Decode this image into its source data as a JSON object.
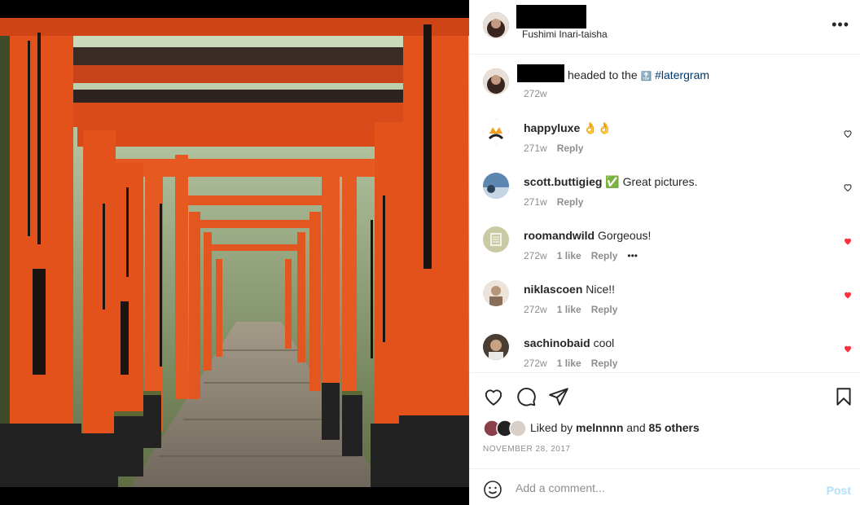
{
  "post": {
    "location": "Fushimi Inari-taisha",
    "more_icon": "more-horizontal-icon",
    "caption_before": "headed to the",
    "caption_emoji": "🔝",
    "caption_hashtag": "#latergram",
    "caption_time": "272w"
  },
  "comments": [
    {
      "user": "happyluxe",
      "text": "👌👌",
      "time": "271w",
      "likes": "",
      "reply": "Reply",
      "liked": false,
      "avatar_color": "#ffffff"
    },
    {
      "user": "scott.buttigieg",
      "text": "✅ Great pictures.",
      "time": "271w",
      "likes": "",
      "reply": "Reply",
      "liked": false,
      "avatar_color": "#4a7aa8"
    },
    {
      "user": "roomandwild",
      "text": "Gorgeous!",
      "time": "272w",
      "likes": "1 like",
      "reply": "Reply",
      "liked": true,
      "avatar_color": "#c9c9a3"
    },
    {
      "user": "niklascoen",
      "text": "Nice!!",
      "time": "272w",
      "likes": "1 like",
      "reply": "Reply",
      "liked": true,
      "avatar_color": "#d9c8b8"
    },
    {
      "user": "sachinobaid",
      "text": "cool",
      "time": "272w",
      "likes": "1 like",
      "reply": "Reply",
      "liked": true,
      "avatar_color": "#6b5a4a"
    }
  ],
  "comment_more": "•••",
  "actions": {
    "likes_prefix": "Liked by",
    "likes_user": "melnnnn",
    "likes_and": "and",
    "likes_others": "85 others",
    "date": "NOVEMBER 28, 2017"
  },
  "add_comment": {
    "placeholder": "Add a comment...",
    "post_label": "Post"
  },
  "colors": {
    "heart_red": "#ff3040",
    "link_blue": "#00376b",
    "post_disabled": "#b2dffc",
    "torii_orange": "#e5521d"
  }
}
